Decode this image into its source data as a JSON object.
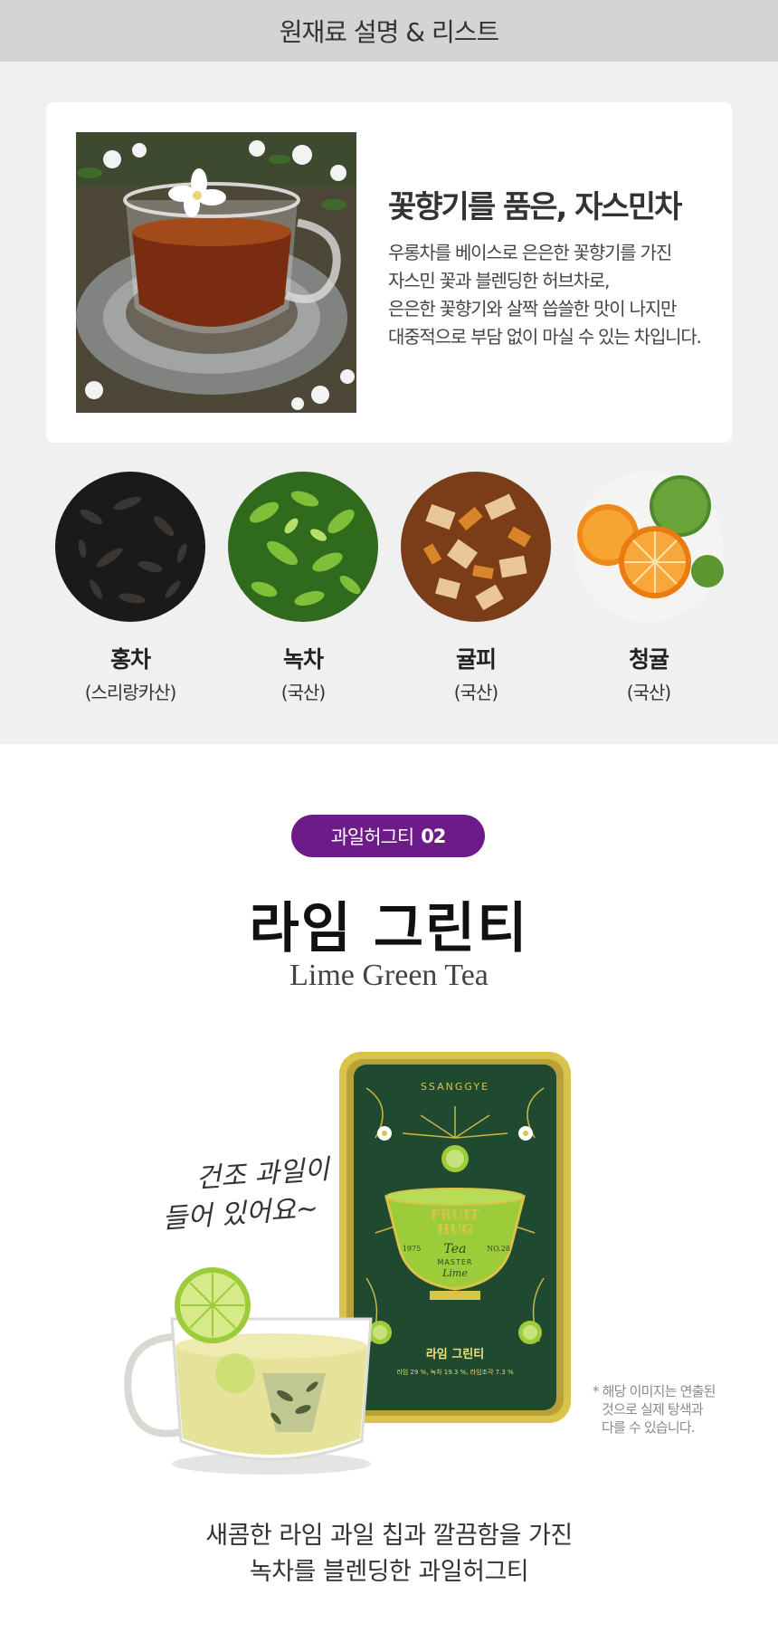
{
  "header": {
    "title": "원재료 설명 & 리스트"
  },
  "jasmine": {
    "title": "꽃향기를 품은, 자스민차",
    "description": [
      "우롱차를 베이스로 은은한 꽃향기를 가진",
      "자스민 꽃과 블렌딩한 허브차로,",
      "은은한 꽃향기와 살짝 씁쓸한 맛이 나지만",
      "대중적으로 부담 없이 마실 수 있는 차입니다."
    ]
  },
  "ingredients": [
    {
      "name": "홍차",
      "origin": "(스리랑카산)",
      "icon": "black-tea-leaves"
    },
    {
      "name": "녹차",
      "origin": "(국산)",
      "icon": "green-tea-plant"
    },
    {
      "name": "귤피",
      "origin": "(국산)",
      "icon": "dried-tangerine-peel"
    },
    {
      "name": "청귤",
      "origin": "(국산)",
      "icon": "green-tangerine"
    }
  ],
  "product": {
    "badge_label": "과일허그티",
    "badge_number": "02",
    "title": "라임 그린티",
    "subtitle": "Lime Green Tea",
    "handwritten": [
      "건조 과일이",
      "들어 있어요~"
    ],
    "tin": {
      "brand": "SSANGGYE",
      "logo_line1": "FRUIT",
      "logo_line2": "HUG",
      "year": "1975",
      "tea_word": "Tea",
      "number": "NO.28",
      "master": "MASTER",
      "flavor": "Lime",
      "product_name": "라임 그린티",
      "ingredients_text": "라임 29 %, 녹차 19.3 %, 라임조각 7.3 %"
    },
    "note": [
      "* 해당 이미지는 연출된",
      "것으로 실제 탕색과",
      "다를 수 있습니다."
    ],
    "closing": [
      "새콤한 라임 과일 칩과 깔끔함을 가진",
      "녹차를 블렌딩한 과일허그티"
    ]
  },
  "colors": {
    "header_bg": "#d4d4d4",
    "section_bg": "#f0f0f0",
    "badge_purple": "#6e1b8a",
    "tin_green": "#1f4a2f",
    "tin_gold": "#d9c34a",
    "lime_green": "#9ccc3a"
  }
}
